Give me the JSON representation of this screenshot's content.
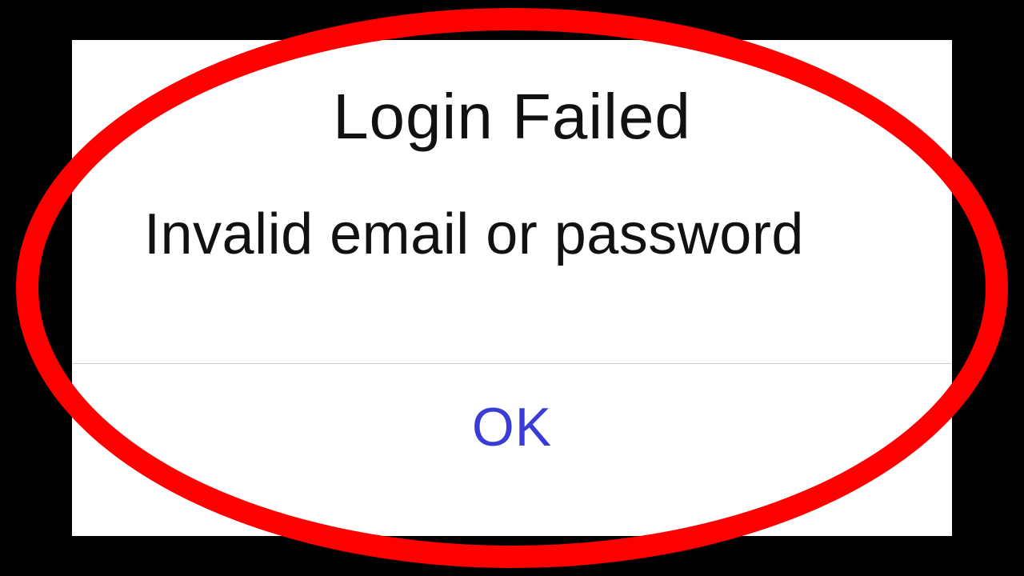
{
  "dialog": {
    "title": "Login Failed",
    "message": "Invalid email or password",
    "ok_label": "OK"
  },
  "annotation": {
    "color": "#ff0000"
  }
}
